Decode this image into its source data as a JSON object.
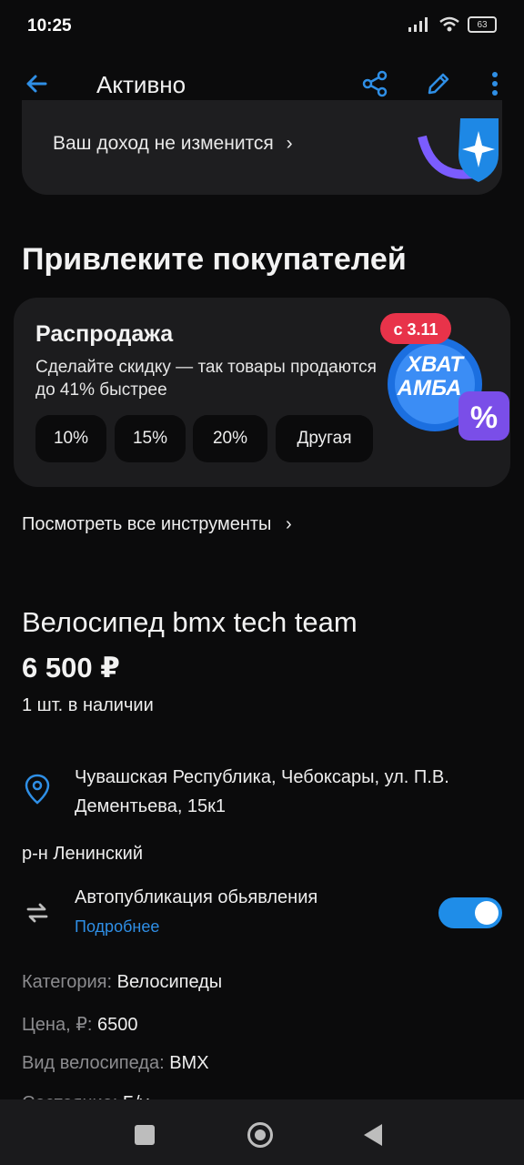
{
  "status": {
    "time": "10:25",
    "battery": "63"
  },
  "header": {
    "title": "Активно"
  },
  "income_card": {
    "text": "Ваш доход не изменится"
  },
  "promote": {
    "title": "Привлеките покупателей"
  },
  "sale": {
    "title": "Распродажа",
    "description": "Сделайте скидку — так товары продаются до 41% быстрее",
    "chips": [
      "10%",
      "15%",
      "20%",
      "Другая"
    ],
    "badge": {
      "date": "с 3.11",
      "word1": "ХВАТ",
      "word2": "АМБА",
      "percent": "%"
    }
  },
  "tools_link": "Посмотреть все инструменты",
  "product": {
    "title": "Велосипед bmx tech team",
    "price": "6 500 ₽",
    "stock": "1 шт. в наличии",
    "address": "Чувашская Республика, Чебоксары, ул. П.В. Дементьева, 15к1",
    "district": "р-н Ленинский"
  },
  "autopublish": {
    "label": "Автопубликация обьявления",
    "link": "Подробнее",
    "enabled": true
  },
  "specs": [
    {
      "key": "Категория:",
      "value": "Велосипеды"
    },
    {
      "key": "Цена, ₽:",
      "value": "6500"
    },
    {
      "key": "Вид велосипеда:",
      "value": "BMX"
    },
    {
      "key": "Состояние:",
      "value": "Б/у"
    }
  ],
  "colors": {
    "accent": "#2f8fe6",
    "card": "#1c1c1e",
    "bg": "#0b0b0c"
  }
}
